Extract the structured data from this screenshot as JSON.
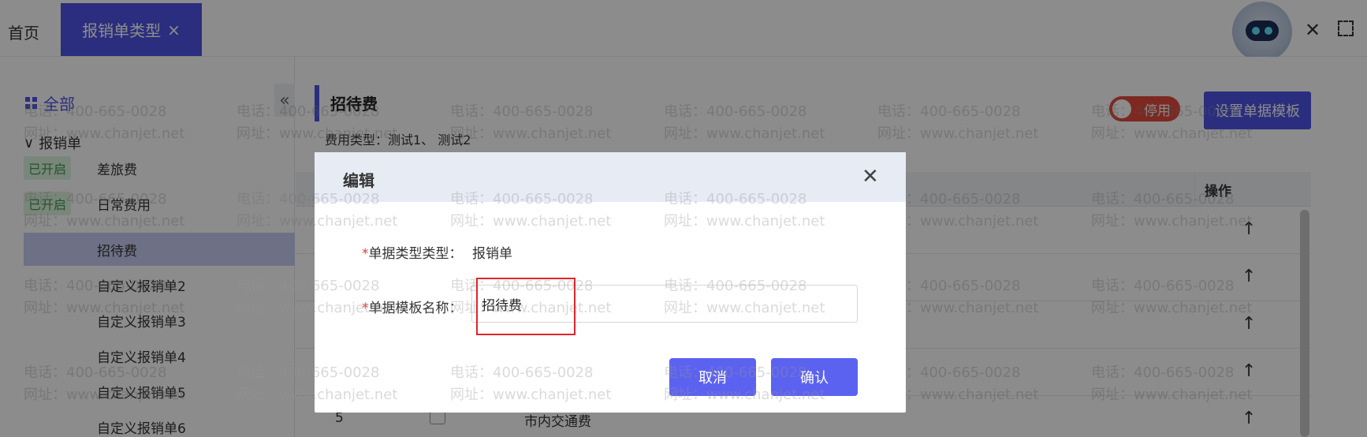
{
  "tabs": {
    "home": "首页",
    "active": "报销单类型",
    "active_close": "×"
  },
  "window": {
    "close": "✕"
  },
  "sidebar": {
    "all_label": "全部",
    "collapse_icon": "«",
    "group_label": "报销单",
    "group_chevron": "∨",
    "items": [
      {
        "badge": "已开启",
        "label": "差旅费"
      },
      {
        "badge": "已开启",
        "label": "日常费用"
      },
      {
        "badge": "",
        "label": "招待费"
      },
      {
        "badge": "",
        "label": "自定义报销单2"
      },
      {
        "badge": "",
        "label": "自定义报销单3"
      },
      {
        "badge": "",
        "label": "自定义报销单4"
      },
      {
        "badge": "",
        "label": "自定义报销单5"
      },
      {
        "badge": "",
        "label": "自定义报销单6"
      }
    ]
  },
  "main": {
    "title": "招待费",
    "fee_types": "费用类型：测试1、 测试2",
    "toggle_label": "停用",
    "set_template_button": "设置单据模板",
    "table": {
      "op_header": "操作",
      "rows": [
        {
          "num": "",
          "name": "",
          "arrow": "↑"
        },
        {
          "num": "",
          "name": "",
          "arrow": "↑"
        },
        {
          "num": "",
          "name": "",
          "arrow": "↑"
        },
        {
          "num": "",
          "name": "",
          "arrow": "↑"
        },
        {
          "num": "5",
          "name": "市内交通费",
          "arrow": "↑"
        }
      ]
    }
  },
  "watermark": {
    "phone": "电话：400-665-0028",
    "site": "网址：www.chanjet.net"
  },
  "dialog": {
    "title": "编辑",
    "close": "✕",
    "field1_label": "单据类型类型：",
    "field1_value": "报销单",
    "field2_label": "单据模板名称：",
    "field2_value": "招待费",
    "required_mark": "*",
    "cancel": "取消",
    "confirm": "确认"
  },
  "colors": {
    "accent": "#4f55e6",
    "danger": "#e4493d",
    "highlight_box": "#e0262a"
  }
}
